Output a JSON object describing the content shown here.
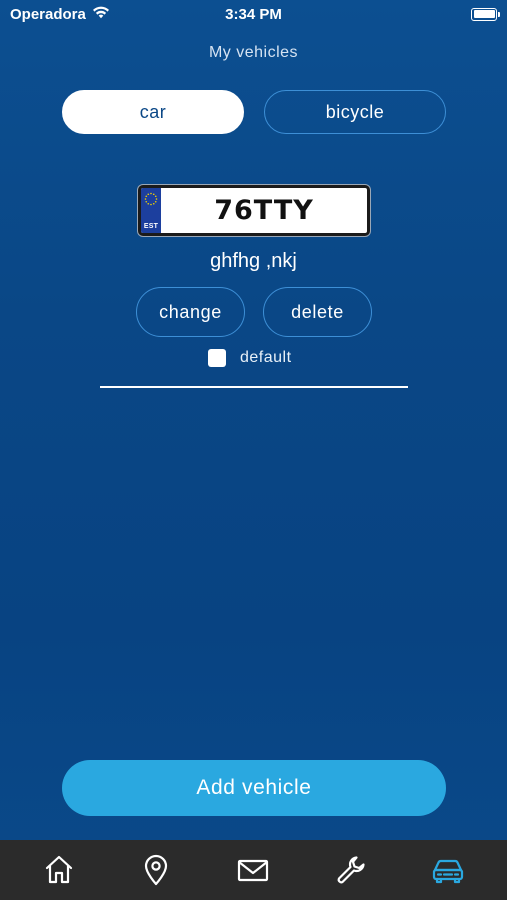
{
  "status_bar": {
    "carrier": "Operadora",
    "time": "3:34 PM"
  },
  "header": {
    "title": "My vehicles"
  },
  "segment": {
    "tabs": [
      {
        "label": "car",
        "active": true
      },
      {
        "label": "bicycle",
        "active": false
      }
    ]
  },
  "vehicle": {
    "plate_country": "EST",
    "plate_number": "76TTY",
    "name": "ghfhg ,nkj",
    "change_label": "change",
    "delete_label": "delete",
    "default_label": "default",
    "default_checked": false
  },
  "add_vehicle_label": "Add vehicle",
  "tab_bar": {
    "items": [
      {
        "icon": "home-icon",
        "active": false
      },
      {
        "icon": "location-pin-icon",
        "active": false
      },
      {
        "icon": "mail-icon",
        "active": false
      },
      {
        "icon": "wrench-icon",
        "active": false
      },
      {
        "icon": "car-icon",
        "active": true
      }
    ],
    "active_color": "#2aa8e0",
    "inactive_color": "#ffffff"
  },
  "colors": {
    "background": "#0a4786",
    "accent": "#2aa8e0",
    "outline": "#3d8fd6"
  }
}
